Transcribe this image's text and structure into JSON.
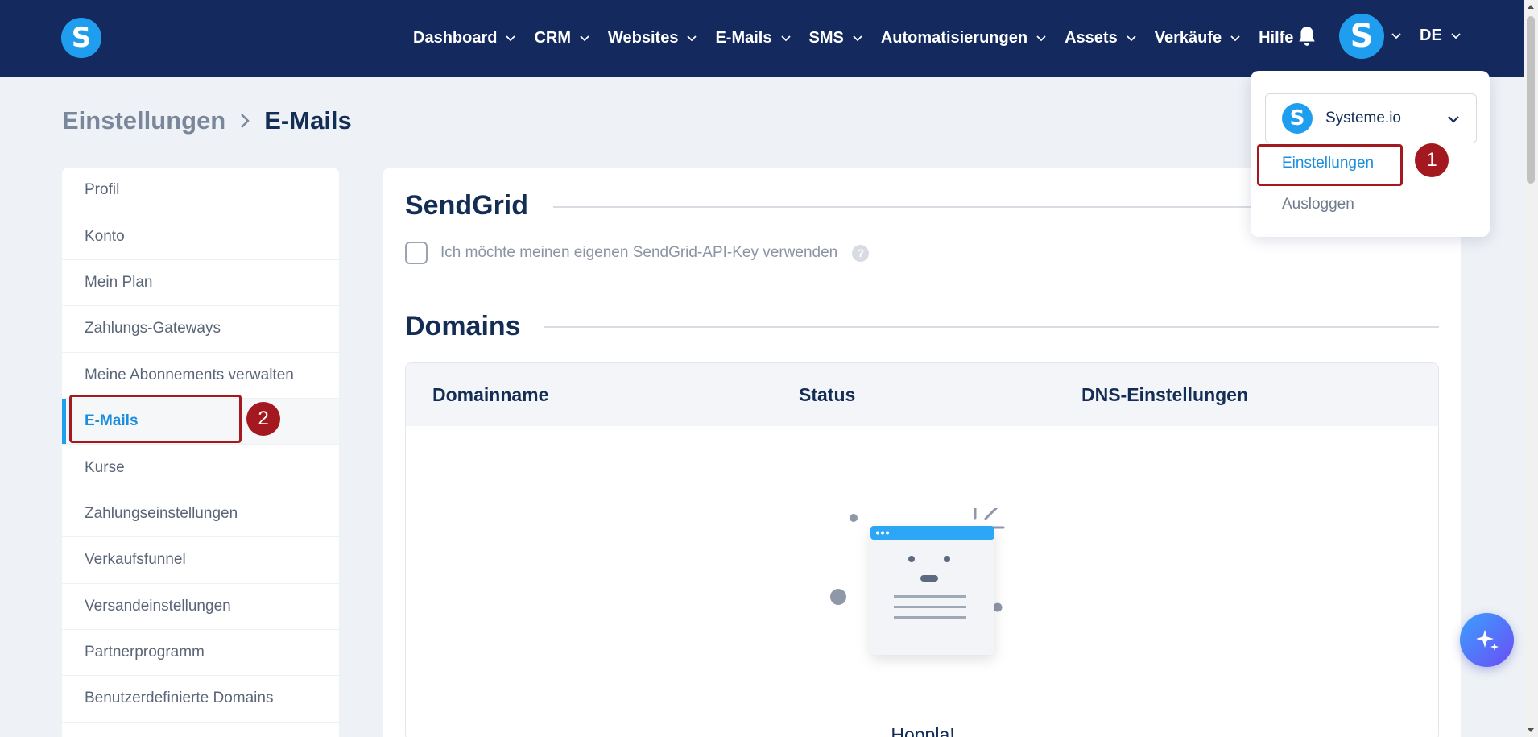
{
  "topbar": {
    "logo_letter": "S",
    "nav": [
      {
        "label": "Dashboard",
        "has_dropdown": true
      },
      {
        "label": "CRM",
        "has_dropdown": true
      },
      {
        "label": "Websites",
        "has_dropdown": true
      },
      {
        "label": "E-Mails",
        "has_dropdown": true
      },
      {
        "label": "SMS",
        "has_dropdown": true
      },
      {
        "label": "Automatisierungen",
        "has_dropdown": true
      },
      {
        "label": "Assets",
        "has_dropdown": true
      },
      {
        "label": "Verkäufe",
        "has_dropdown": true
      },
      {
        "label": "Hilfe",
        "has_dropdown": false
      }
    ],
    "notification_icon": "bell-icon",
    "avatar_letter": "S",
    "language": "DE",
    "background_color": "#14295e"
  },
  "breadcrumb": {
    "parent": "Einstellungen",
    "current": "E-Mails"
  },
  "sidebar": {
    "items": [
      {
        "label": "Profil",
        "active": false
      },
      {
        "label": "Konto",
        "active": false
      },
      {
        "label": "Mein Plan",
        "active": false
      },
      {
        "label": "Zahlungs-Gateways",
        "active": false
      },
      {
        "label": "Meine Abonnements verwalten",
        "active": false
      },
      {
        "label": "E-Mails",
        "active": true
      },
      {
        "label": "Kurse",
        "active": false
      },
      {
        "label": "Zahlungseinstellungen",
        "active": false
      },
      {
        "label": "Verkaufsfunnel",
        "active": false
      },
      {
        "label": "Versandeinstellungen",
        "active": false
      },
      {
        "label": "Partnerprogramm",
        "active": false
      },
      {
        "label": "Benutzerdefinierte Domains",
        "active": false
      }
    ]
  },
  "main": {
    "sendgrid": {
      "title": "SendGrid",
      "checkbox_label": "Ich möchte meinen eigenen SendGrid-API-Key verwenden",
      "checked": false,
      "help_glyph": "?"
    },
    "domains": {
      "title": "Domains",
      "columns": [
        "Domainname",
        "Status",
        "DNS-Einstellungen"
      ],
      "empty_text": "Hopplа!"
    }
  },
  "dropdown": {
    "account_name": "Systeme.io",
    "account_letter": "S",
    "settings_label": "Einstellungen",
    "logout_label": "Ausloggen"
  },
  "annotations": [
    {
      "number": "1",
      "target": "Einstellungen"
    },
    {
      "number": "2",
      "target": "E-Mails"
    }
  ],
  "colors": {
    "accent": "#1f9ef0",
    "annotation": "#a4191f",
    "link": "#1b8ede"
  }
}
